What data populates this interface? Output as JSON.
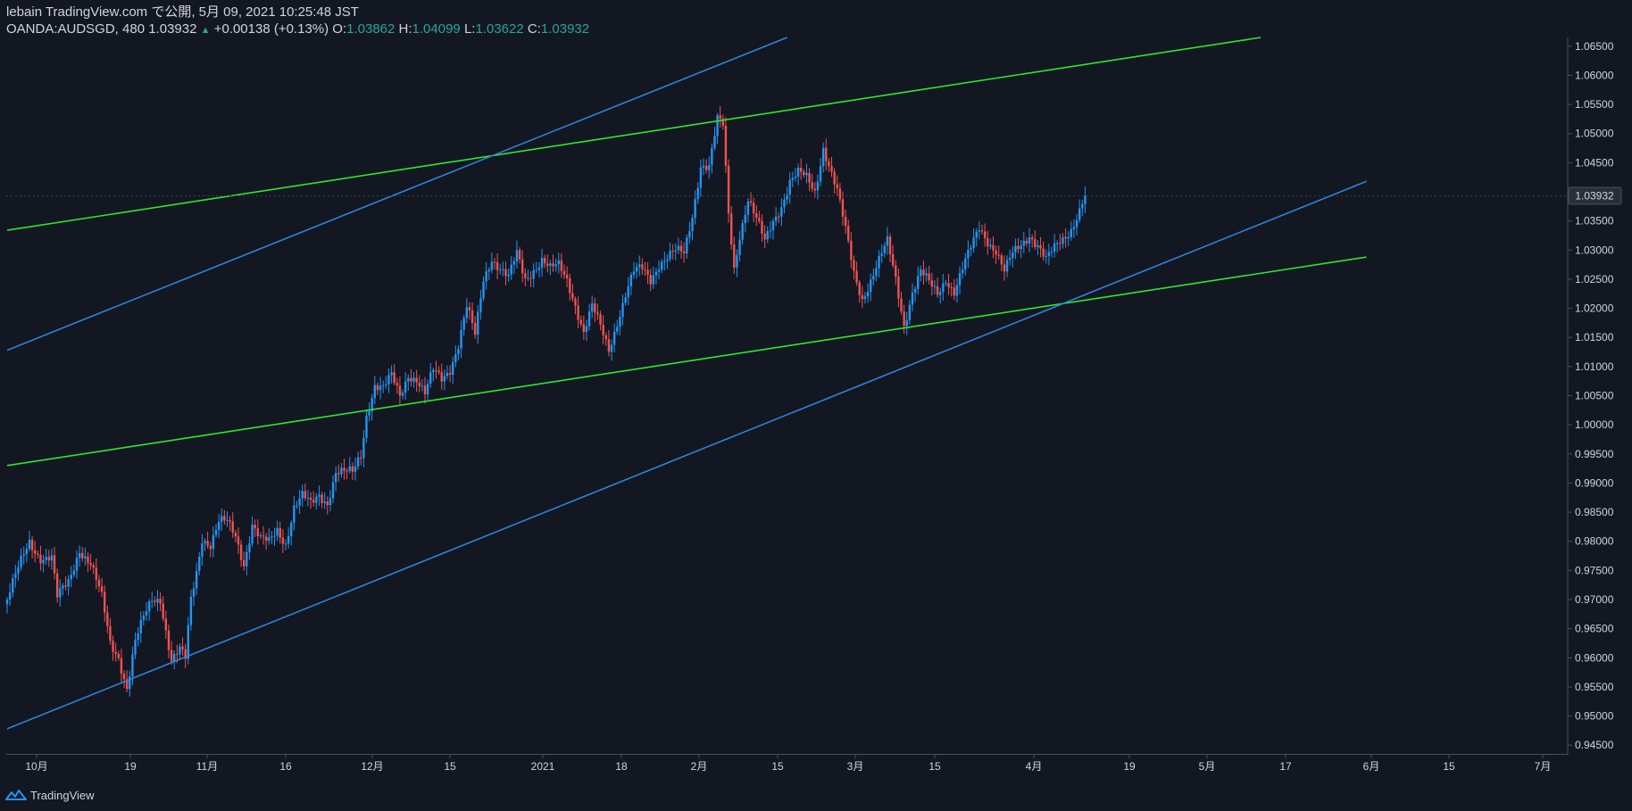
{
  "header": {
    "line1": "lebain TradingView.com で公開, 5月 09, 2021 10:25:48 JST",
    "symbol": "OANDA:AUDSGD, 480",
    "last": "1.03932",
    "change": "+0.00138 (+0.13%)",
    "o_label": "O:",
    "o_value": "1.03862",
    "h_label": "H:",
    "h_value": "1.04099",
    "l_label": "L:",
    "l_value": "1.03622",
    "c_label": "C:",
    "c_value": "1.03932"
  },
  "footer": {
    "brand": "TradingView",
    "logo_icon": "tradingview-logo-icon"
  },
  "colors": {
    "background": "#131722",
    "up": "#2196f3",
    "down": "#ef5350",
    "trend_green": "#2ee82e",
    "trend_blue": "#2f83d8",
    "axis_text": "#d1d4dc"
  },
  "chart_data": {
    "type": "candlestick",
    "symbol": "OANDA:AUDSGD",
    "interval": "480",
    "x_axis_labels": [
      "10月",
      "19",
      "11月",
      "16",
      "12月",
      "15",
      "2021",
      "18",
      "2月",
      "15",
      "3月",
      "15",
      "4月",
      "19",
      "5月",
      "17",
      "6月",
      "15",
      "7月"
    ],
    "y_axis_labels": [
      "1.06500",
      "1.06000",
      "1.05500",
      "1.05000",
      "1.04500",
      "1.04000",
      "1.03500",
      "1.03000",
      "1.02500",
      "1.02000",
      "1.01500",
      "1.01000",
      "1.00500",
      "1.00000",
      "0.99500",
      "0.99000",
      "0.98500",
      "0.98000",
      "0.97500",
      "0.97000",
      "0.96500",
      "0.96000",
      "0.95500",
      "0.95000",
      "0.94500"
    ],
    "ylim": [
      0.9435,
      1.0665
    ],
    "last_price_label": "1.03932",
    "close_path": [
      [
        0,
        0.97
      ],
      [
        4,
        0.975
      ],
      [
        8,
        0.98
      ],
      [
        12,
        0.9775
      ],
      [
        16,
        0.977
      ],
      [
        18,
        0.97
      ],
      [
        22,
        0.973
      ],
      [
        26,
        0.979
      ],
      [
        30,
        0.976
      ],
      [
        34,
        0.97
      ],
      [
        37,
        0.9625
      ],
      [
        40,
        0.9605
      ],
      [
        43,
        0.955
      ],
      [
        46,
        0.9625
      ],
      [
        49,
        0.9665
      ],
      [
        52,
        0.97
      ],
      [
        55,
        0.9705
      ],
      [
        57,
        0.965
      ],
      [
        59,
        0.9595
      ],
      [
        62,
        0.961
      ],
      [
        64,
        0.9595
      ],
      [
        66,
        0.97
      ],
      [
        68,
        0.975
      ],
      [
        70,
        0.981
      ],
      [
        73,
        0.9795
      ],
      [
        76,
        0.983
      ],
      [
        79,
        0.983
      ],
      [
        82,
        0.981
      ],
      [
        85,
        0.9765
      ],
      [
        88,
        0.983
      ],
      [
        91,
        0.98
      ],
      [
        94,
        0.9795
      ],
      [
        97,
        0.982
      ],
      [
        100,
        0.98
      ],
      [
        103,
        0.986
      ],
      [
        106,
        0.9875
      ],
      [
        109,
        0.986
      ],
      [
        112,
        0.988
      ],
      [
        115,
        0.987
      ],
      [
        118,
        0.992
      ],
      [
        121,
        0.9915
      ],
      [
        124,
        0.9915
      ],
      [
        127,
        0.995
      ],
      [
        129,
        1.002
      ],
      [
        132,
        1.007
      ],
      [
        135,
        1.006
      ],
      [
        138,
        1.008
      ],
      [
        141,
        1.005
      ],
      [
        144,
        1.009
      ],
      [
        147,
        1.008
      ],
      [
        150,
        1.005
      ],
      [
        153,
        1.009
      ],
      [
        156,
        1.008
      ],
      [
        159,
        1.01
      ],
      [
        162,
        1.014
      ],
      [
        165,
        1.02
      ],
      [
        168,
        1.015
      ],
      [
        171,
        1.025
      ],
      [
        174,
        1.029
      ],
      [
        177,
        1.027
      ],
      [
        180,
        1.025
      ],
      [
        183,
        1.029
      ],
      [
        186,
        1.025
      ],
      [
        189,
        1.027
      ],
      [
        192,
        1.0285
      ],
      [
        195,
        1.0265
      ],
      [
        198,
        1.027
      ],
      [
        201,
        1.025
      ],
      [
        204,
        1.021
      ],
      [
        207,
        1.016
      ],
      [
        210,
        1.02
      ],
      [
        213,
        1.0165
      ],
      [
        216,
        1.013
      ],
      [
        219,
        1.018
      ],
      [
        222,
        1.0225
      ],
      [
        225,
        1.026
      ],
      [
        228,
        1.0265
      ],
      [
        231,
        1.025
      ],
      [
        234,
        1.028
      ],
      [
        237,
        1.029
      ],
      [
        240,
        1.0295
      ],
      [
        243,
        1.029
      ],
      [
        246,
        1.036
      ],
      [
        249,
        1.045
      ],
      [
        252,
        1.0445
      ],
      [
        255,
        1.052
      ],
      [
        257,
        1.051
      ],
      [
        259,
        1.036
      ],
      [
        261,
        1.027
      ],
      [
        263,
        1.033
      ],
      [
        266,
        1.039
      ],
      [
        269,
        1.035
      ],
      [
        272,
        1.031
      ],
      [
        275,
        1.035
      ],
      [
        278,
        1.038
      ],
      [
        281,
        1.042
      ],
      [
        284,
        1.043
      ],
      [
        287,
        1.042
      ],
      [
        290,
        1.04
      ],
      [
        293,
        1.048
      ],
      [
        295,
        1.045
      ],
      [
        298,
        1.04
      ],
      [
        301,
        1.033
      ],
      [
        304,
        1.026
      ],
      [
        307,
        1.022
      ],
      [
        310,
        1.025
      ],
      [
        313,
        1.028
      ],
      [
        316,
        1.031
      ],
      [
        319,
        1.025
      ],
      [
        322,
        1.0175
      ],
      [
        325,
        1.023
      ],
      [
        328,
        1.026
      ],
      [
        331,
        1.024
      ],
      [
        334,
        1.0225
      ],
      [
        337,
        1.0255
      ],
      [
        340,
        1.023
      ],
      [
        343,
        1.0265
      ],
      [
        346,
        1.03
      ],
      [
        349,
        1.034
      ],
      [
        352,
        1.032
      ],
      [
        355,
        1.03
      ],
      [
        358,
        1.026
      ],
      [
        361,
        1.029
      ],
      [
        364,
        1.031
      ],
      [
        367,
        1.033
      ],
      [
        370,
        1.031
      ],
      [
        373,
        1.028
      ],
      [
        376,
        1.03
      ],
      [
        379,
        1.032
      ],
      [
        382,
        1.034
      ],
      [
        385,
        1.037
      ],
      [
        387,
        1.0393
      ]
    ],
    "trend_lines": [
      {
        "color": "trend_green",
        "from": [
          0,
          1.0334
        ],
        "to": [
          450,
          1.0665
        ]
      },
      {
        "color": "trend_green",
        "from": [
          0,
          0.993
        ],
        "to": [
          488,
          1.0288
        ]
      },
      {
        "color": "trend_blue",
        "from": [
          0,
          1.0128
        ],
        "to": [
          280,
          1.0665
        ]
      },
      {
        "color": "trend_blue",
        "from": [
          0,
          0.9478
        ],
        "to": [
          488,
          1.0418
        ]
      }
    ]
  }
}
